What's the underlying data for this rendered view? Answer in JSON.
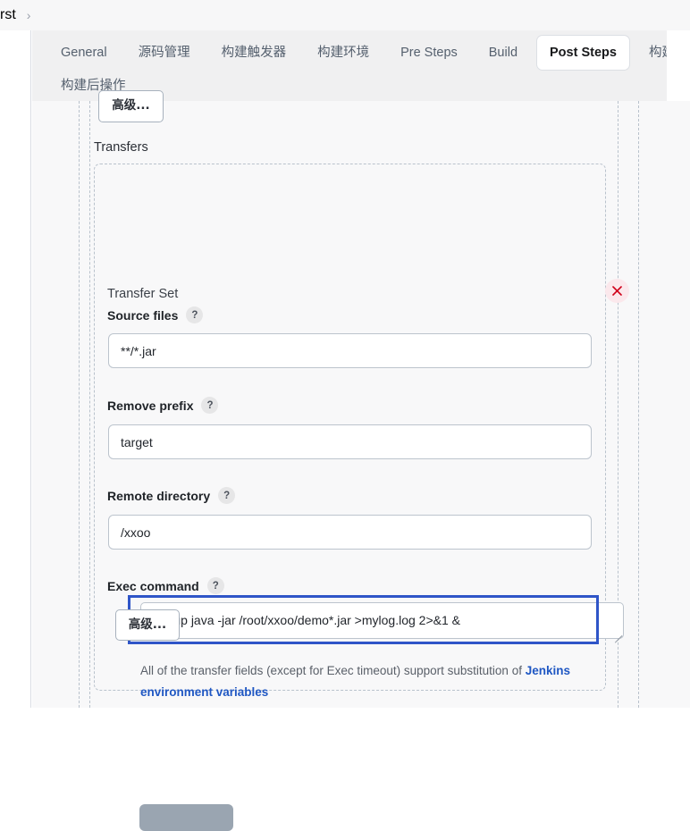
{
  "breadcrumb": {
    "trailing_text": "rst",
    "chevron": "chevron-right"
  },
  "tabs": {
    "row1": [
      {
        "label": "General",
        "active": false
      },
      {
        "label": "源码管理",
        "active": false
      },
      {
        "label": "构建触发器",
        "active": false
      },
      {
        "label": "构建环境",
        "active": false
      },
      {
        "label": "Pre Steps",
        "active": false
      },
      {
        "label": "Build",
        "active": false
      },
      {
        "label": "Post Steps",
        "active": true
      },
      {
        "label": "构建设置",
        "active": false
      }
    ],
    "row2": [
      {
        "label": "构建后操作",
        "active": false
      }
    ]
  },
  "main": {
    "advanced_button_top": "高级...",
    "transfers_label": "Transfers",
    "transfer_set": {
      "title": "Transfer Set",
      "delete_icon": "close-x-icon",
      "fields": [
        {
          "label": "Source files",
          "help": "?",
          "value": "**/*.jar"
        },
        {
          "label": "Remove prefix",
          "help": "?",
          "value": "target"
        },
        {
          "label": "Remote directory",
          "help": "?",
          "value": "/xxoo"
        },
        {
          "label": "Exec command",
          "help": "?",
          "value": "nohup java -jar /root/xxoo/demo*.jar >mylog.log 2>&1 &"
        }
      ],
      "helper_text_prefix": "All of the transfer fields (except for Exec timeout) support substitution of ",
      "helper_link": "Jenkins environment variables",
      "advanced_button": "高级..."
    }
  },
  "colors": {
    "accent_blue": "#2f55c8",
    "link_blue": "#1f57c3",
    "danger_red": "#d0021b",
    "danger_bg": "#fbe8ec",
    "canvas_bg": "#f8f8f9",
    "tabbar_bg": "#f0f0f1",
    "dashed_guide": "#b9c2cc"
  }
}
